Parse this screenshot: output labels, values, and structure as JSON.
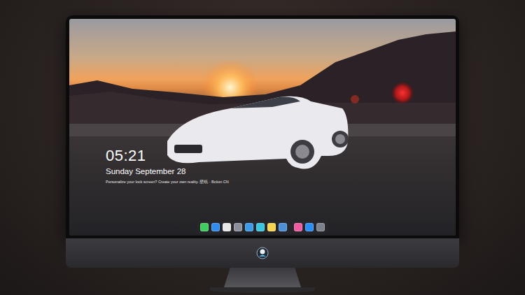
{
  "lock_screen": {
    "time": "05:21",
    "date": "Sunday September 28",
    "caption": "Personalize your lock screen? Create your own reality. 壁纸 · Bction CN"
  },
  "dock": {
    "items": [
      {
        "color": "#3ecf5c"
      },
      {
        "color": "#2f8cf0"
      },
      {
        "color": "#e8e8e8"
      },
      {
        "color": "#8a8f99"
      },
      {
        "color": "#3a9be8"
      },
      {
        "color": "#38c5e0"
      },
      {
        "color": "#f7d54a"
      },
      {
        "color": "#4a90d9"
      },
      {
        "color": "#f05aa0"
      },
      {
        "color": "#2a8cf5"
      },
      {
        "color": "#7d8189"
      }
    ]
  }
}
